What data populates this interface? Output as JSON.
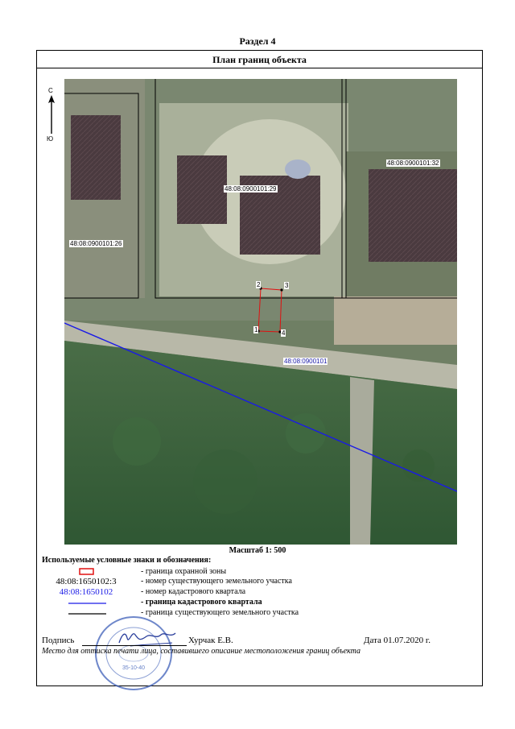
{
  "section_title": "Раздел 4",
  "plan_title": "План границ объекта",
  "compass": {
    "north": "С",
    "south": "Ю"
  },
  "map": {
    "plot_labels": [
      "48:08:0900101:26",
      "48:08:0900101:29",
      "48:08:0900101:32"
    ],
    "quarter_label": "48:08:0900101",
    "points": [
      "1",
      "2",
      "3",
      "4"
    ],
    "colors": {
      "zone_boundary": "#e01010",
      "quarter_boundary": "#1a1ae6",
      "plot_boundary": "#000000"
    }
  },
  "scale": "Масштаб 1: 500",
  "legend": {
    "title": "Используемые условные знаки и обозначения:",
    "items": [
      {
        "symbol": "red-rect",
        "symbol_text": "",
        "text": "- граница охранной зоны"
      },
      {
        "symbol": "text",
        "symbol_text": "48:08:1650102:3",
        "text": "- номер существующего земельного участка"
      },
      {
        "symbol": "text-blue",
        "symbol_text": "48:08:1650102",
        "text": "- номер кадастрового квартала"
      },
      {
        "symbol": "blue-line",
        "symbol_text": "",
        "text": "- граница кадастрового квартала"
      },
      {
        "symbol": "black-line",
        "symbol_text": "",
        "text": "- граница существующего земельного участка"
      }
    ]
  },
  "signature": {
    "label": "Подпись",
    "name": "Хурчак Е.В.",
    "date": "Дата 01.07.2020 г."
  },
  "note": "Место для оттиска печати лица, составившего описание местоположения границ объекта",
  "stamp": {
    "text": "35-10-40"
  }
}
